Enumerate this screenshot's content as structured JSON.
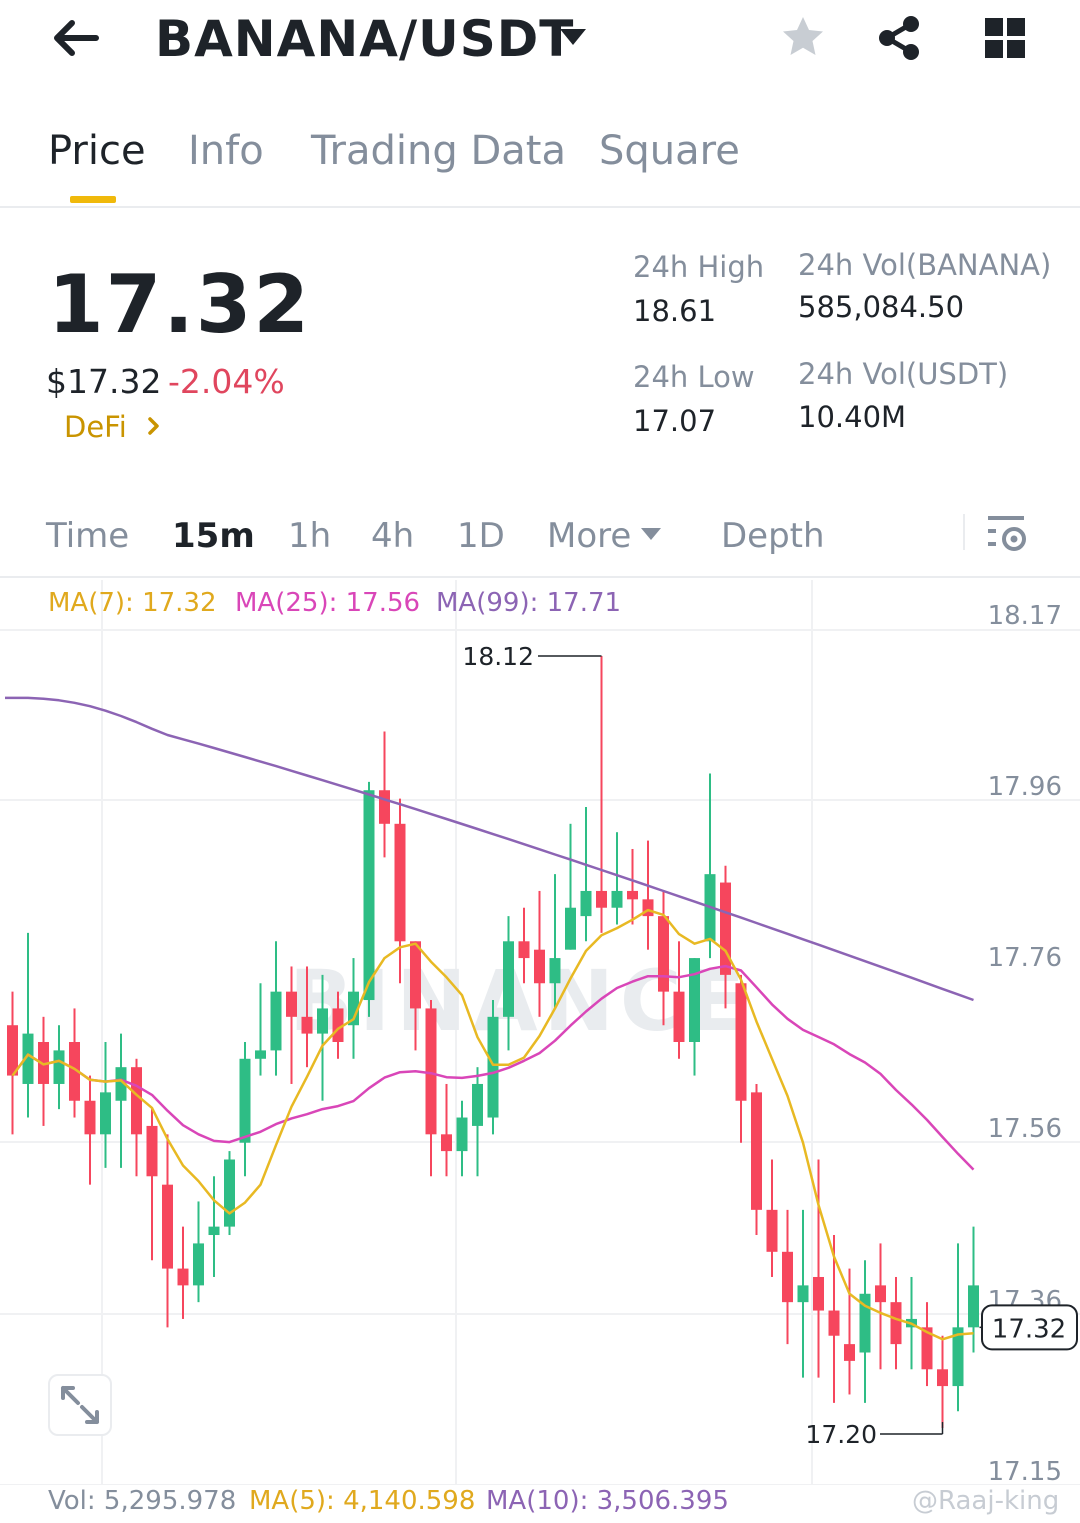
{
  "header": {
    "pair": "BANANA/USDT",
    "icons": [
      "back-arrow-icon",
      "caret-down-icon",
      "star-icon",
      "share-icon",
      "grid-icon"
    ]
  },
  "tabs": [
    {
      "label": "Price",
      "active": true
    },
    {
      "label": "Info",
      "active": false
    },
    {
      "label": "Trading Data",
      "active": false
    },
    {
      "label": "Square",
      "active": false
    }
  ],
  "price": {
    "last": "17.32",
    "usd": "$17.32",
    "change_pct": "-2.04%",
    "category": "DeFi"
  },
  "stats": {
    "high_label": "24h High",
    "high_value": "18.61",
    "low_label": "24h Low",
    "low_value": "17.07",
    "vol_base_label": "24h Vol(BANANA)",
    "vol_base_value": "585,084.50",
    "vol_quote_label": "24h Vol(USDT)",
    "vol_quote_value": "10.40M"
  },
  "intervals": [
    {
      "label": "Time",
      "active": false
    },
    {
      "label": "15m",
      "active": true
    },
    {
      "label": "1h",
      "active": false
    },
    {
      "label": "4h",
      "active": false
    },
    {
      "label": "1D",
      "active": false
    },
    {
      "label": "More",
      "active": false
    },
    {
      "label": "Depth",
      "active": false
    }
  ],
  "ma_legend": {
    "ma7": "MA(7): 17.32",
    "ma25": "MA(25): 17.56",
    "ma99": "MA(99): 17.71"
  },
  "vol_legend": {
    "vol": "Vol: 5,295.978",
    "ma5": "MA(5): 4,140.598",
    "ma10": "MA(10): 3,506.395"
  },
  "watermark": "@Raaj-king",
  "colors": {
    "up": "#2ebd85",
    "down": "#f6465d",
    "ma7": "#e8b923",
    "ma25": "#d946b8",
    "ma99": "#8c64b4",
    "accent": "#f0b90b",
    "negative_text": "#e0465e"
  },
  "chart_data": {
    "type": "candlestick",
    "y_ticks": [
      "18.17",
      "17.96",
      "17.76",
      "17.56",
      "17.36",
      "17.15"
    ],
    "ylim": [
      17.15,
      18.17
    ],
    "current_price_label": "17.32",
    "high_marker": "18.12",
    "low_marker": "17.20",
    "candles": [
      [
        17.68,
        17.62,
        17.72,
        17.55
      ],
      [
        17.61,
        17.67,
        17.79,
        17.57
      ],
      [
        17.66,
        17.61,
        17.69,
        17.56
      ],
      [
        17.61,
        17.65,
        17.68,
        17.58
      ],
      [
        17.66,
        17.59,
        17.7,
        17.57
      ],
      [
        17.59,
        17.55,
        17.62,
        17.49
      ],
      [
        17.55,
        17.6,
        17.66,
        17.51
      ],
      [
        17.59,
        17.63,
        17.67,
        17.51
      ],
      [
        17.63,
        17.55,
        17.64,
        17.5
      ],
      [
        17.56,
        17.5,
        17.58,
        17.4
      ],
      [
        17.49,
        17.39,
        17.55,
        17.32
      ],
      [
        17.39,
        17.37,
        17.44,
        17.33
      ],
      [
        17.37,
        17.42,
        17.47,
        17.35
      ],
      [
        17.43,
        17.44,
        17.5,
        17.38
      ],
      [
        17.44,
        17.52,
        17.53,
        17.43
      ],
      [
        17.54,
        17.64,
        17.66,
        17.5
      ],
      [
        17.64,
        17.65,
        17.73,
        17.62
      ],
      [
        17.65,
        17.72,
        17.78,
        17.62
      ],
      [
        17.72,
        17.69,
        17.75,
        17.61
      ],
      [
        17.69,
        17.67,
        17.75,
        17.63
      ],
      [
        17.67,
        17.7,
        17.74,
        17.59
      ],
      [
        17.7,
        17.66,
        17.72,
        17.64
      ],
      [
        17.68,
        17.72,
        17.76,
        17.64
      ],
      [
        17.71,
        17.96,
        17.97,
        17.69
      ],
      [
        17.96,
        17.92,
        18.03,
        17.88
      ],
      [
        17.92,
        17.78,
        17.95,
        17.73
      ],
      [
        17.78,
        17.7,
        17.78,
        17.65
      ],
      [
        17.7,
        17.55,
        17.71,
        17.5
      ],
      [
        17.55,
        17.53,
        17.61,
        17.5
      ],
      [
        17.53,
        17.57,
        17.59,
        17.5
      ],
      [
        17.56,
        17.61,
        17.63,
        17.5
      ],
      [
        17.57,
        17.69,
        17.71,
        17.55
      ],
      [
        17.69,
        17.78,
        17.81,
        17.65
      ],
      [
        17.78,
        17.76,
        17.82,
        17.73
      ],
      [
        17.77,
        17.73,
        17.84,
        17.69
      ],
      [
        17.73,
        17.76,
        17.86,
        17.7
      ],
      [
        17.77,
        17.82,
        17.92,
        17.77
      ],
      [
        17.81,
        17.84,
        17.94,
        17.78
      ],
      [
        17.84,
        17.82,
        18.12,
        17.79
      ],
      [
        17.82,
        17.84,
        17.91,
        17.8
      ],
      [
        17.84,
        17.83,
        17.89,
        17.8
      ],
      [
        17.83,
        17.81,
        17.9,
        17.77
      ],
      [
        17.81,
        17.72,
        17.84,
        17.68
      ],
      [
        17.72,
        17.66,
        17.78,
        17.64
      ],
      [
        17.66,
        17.76,
        17.76,
        17.62
      ],
      [
        17.78,
        17.86,
        17.98,
        17.76
      ],
      [
        17.85,
        17.74,
        17.87,
        17.7
      ],
      [
        17.73,
        17.59,
        17.74,
        17.54
      ],
      [
        17.6,
        17.46,
        17.61,
        17.43
      ],
      [
        17.46,
        17.41,
        17.52,
        17.38
      ],
      [
        17.41,
        17.35,
        17.46,
        17.3
      ],
      [
        17.35,
        17.37,
        17.46,
        17.26
      ],
      [
        17.38,
        17.34,
        17.52,
        17.26
      ],
      [
        17.34,
        17.31,
        17.43,
        17.23
      ],
      [
        17.3,
        17.28,
        17.39,
        17.24
      ],
      [
        17.29,
        17.36,
        17.4,
        17.23
      ],
      [
        17.37,
        17.35,
        17.42,
        17.27
      ],
      [
        17.35,
        17.3,
        17.38,
        17.27
      ],
      [
        17.32,
        17.33,
        17.38,
        17.27
      ],
      [
        17.32,
        17.27,
        17.35,
        17.25
      ],
      [
        17.27,
        17.25,
        17.31,
        17.2
      ],
      [
        17.25,
        17.32,
        17.42,
        17.22
      ],
      [
        17.32,
        17.37,
        17.44,
        17.29
      ]
    ]
  }
}
